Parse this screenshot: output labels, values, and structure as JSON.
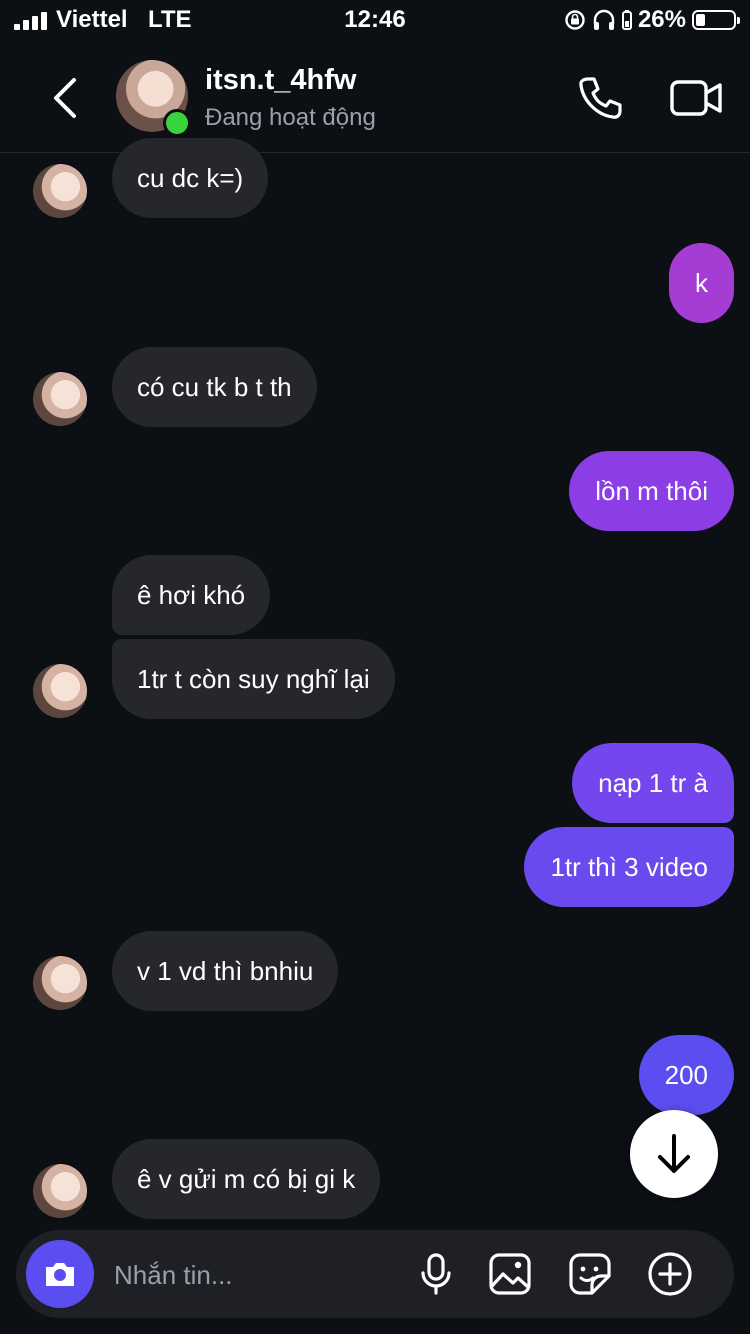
{
  "status_bar": {
    "carrier": "Viettel",
    "network": "LTE",
    "time": "12:46",
    "battery_percent": "26%",
    "battery_level": 0.26
  },
  "header": {
    "contact_name": "itsn.t_4hfw",
    "status": "Đang hoạt động",
    "online_color": "#3bd33b"
  },
  "messages": [
    {
      "direction": "in",
      "text": "cu dc k=)"
    },
    {
      "direction": "out",
      "text": "k"
    },
    {
      "direction": "in",
      "text": "có cu tk b t th"
    },
    {
      "direction": "out",
      "text": "lồn m thôi"
    },
    {
      "direction": "in",
      "text": "ê hơi khó"
    },
    {
      "direction": "in",
      "text": "1tr t còn suy nghĩ lại"
    },
    {
      "direction": "out",
      "text": "nạp 1 tr à"
    },
    {
      "direction": "out",
      "text": "1tr thì 3 video"
    },
    {
      "direction": "in",
      "text": "v 1 vd thì bnhiu"
    },
    {
      "direction": "out",
      "text": "200"
    },
    {
      "direction": "in",
      "text": "ê v gửi m có bị gi k"
    }
  ],
  "colors": {
    "incoming_bubble": "#25272c",
    "outgoing_gradient": [
      "#a03ad8",
      "#6a4bf0",
      "#5b4ef0"
    ],
    "background": "#0c0f14"
  },
  "composer": {
    "placeholder": "Nhắn tin...",
    "icons": [
      "camera-icon",
      "microphone-icon",
      "gallery-icon",
      "sticker-icon",
      "plus-circle-icon"
    ]
  }
}
